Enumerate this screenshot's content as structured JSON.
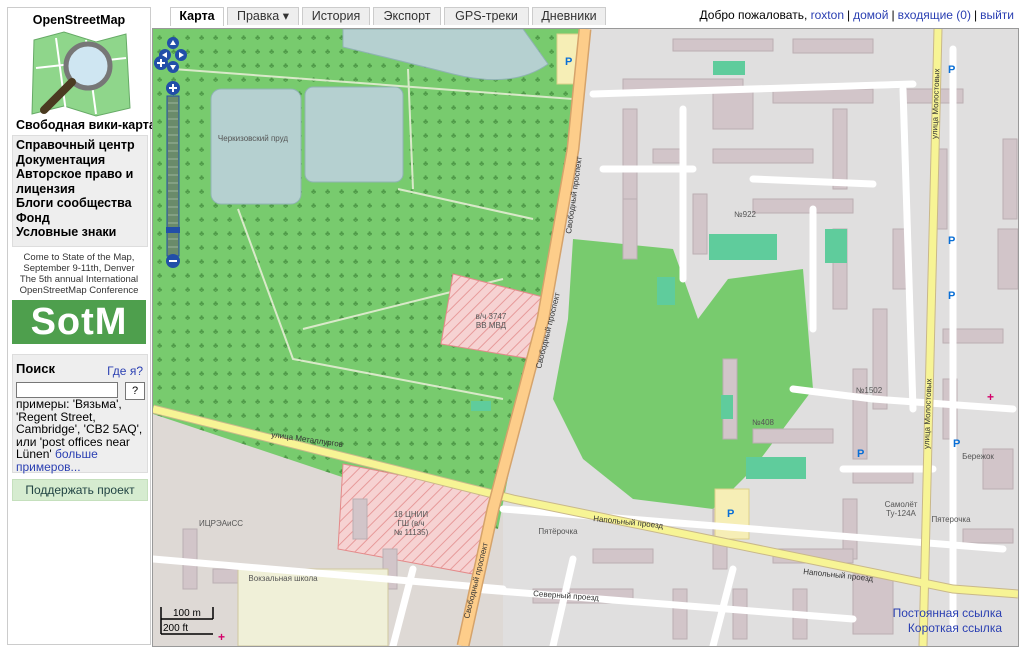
{
  "sidebar": {
    "site_name": "OpenStreetMap",
    "tagline": "Свободная вики-карта мира",
    "links": [
      "Справочный центр",
      "Документация",
      "Авторское право и лицензия",
      "Блоги сообщества",
      "Фонд",
      "Условные знаки"
    ],
    "sotm": {
      "line1": "Come to State of the Map,",
      "line2": "September 9-11th, Denver",
      "line3": "The 5th annual International",
      "line4": "OpenStreetMap Conference",
      "logo": "SotM"
    },
    "search": {
      "title": "Поиск",
      "where": "Где я?",
      "button": "?",
      "examples_intro": "примеры: 'Вязьма', 'Regent Street, Cambridge', 'CB2 5AQ', или 'post offices near Lünen'",
      "more": "больше примеров..."
    },
    "donate": "Поддержать проект"
  },
  "tabs": [
    "Карта",
    "Правка ▾",
    "История",
    "Экспорт",
    "GPS-треки",
    "Дневники"
  ],
  "user": {
    "greeting": "Добро пожаловать,",
    "name": "roxton",
    "home": "домой",
    "inbox": "входящие (0)",
    "logout": "выйти"
  },
  "map": {
    "scale_m": "100 m",
    "scale_ft": "200 ft",
    "permalink": "Постоянная ссылка",
    "shortlink": "Короткая ссылка",
    "streets": [
      "Свободный проспект",
      "Свободный проспект",
      "улица Металлургов",
      "Напольный проезд",
      "Напольный проезд",
      "Северный проезд",
      "Свободный проспект",
      "улица Молостовых",
      "улица Молостовых"
    ],
    "labels": [
      "в/ч 3747",
      "ВВ МВД",
      "18 ЦНИИ",
      "ГШ (в/ч",
      "№ 11135)",
      "ИЦРЭАиСС",
      "№922",
      "№408",
      "№1502",
      "Самолёт",
      "Ту-124А",
      "Пятерочка",
      "Бережок",
      "Пятёрочка",
      "Вокзальная школа",
      "Черкизовский пруд"
    ]
  },
  "colors": {
    "park": "#6cc66c",
    "forest": "#8fd68b",
    "water": "#b5d0d0",
    "building": "#d2c5c9",
    "road_primary": "#fdcd8a",
    "road_secondary": "#f7f495",
    "military": "#f0a8a8",
    "residential": "#e0dfdf"
  }
}
